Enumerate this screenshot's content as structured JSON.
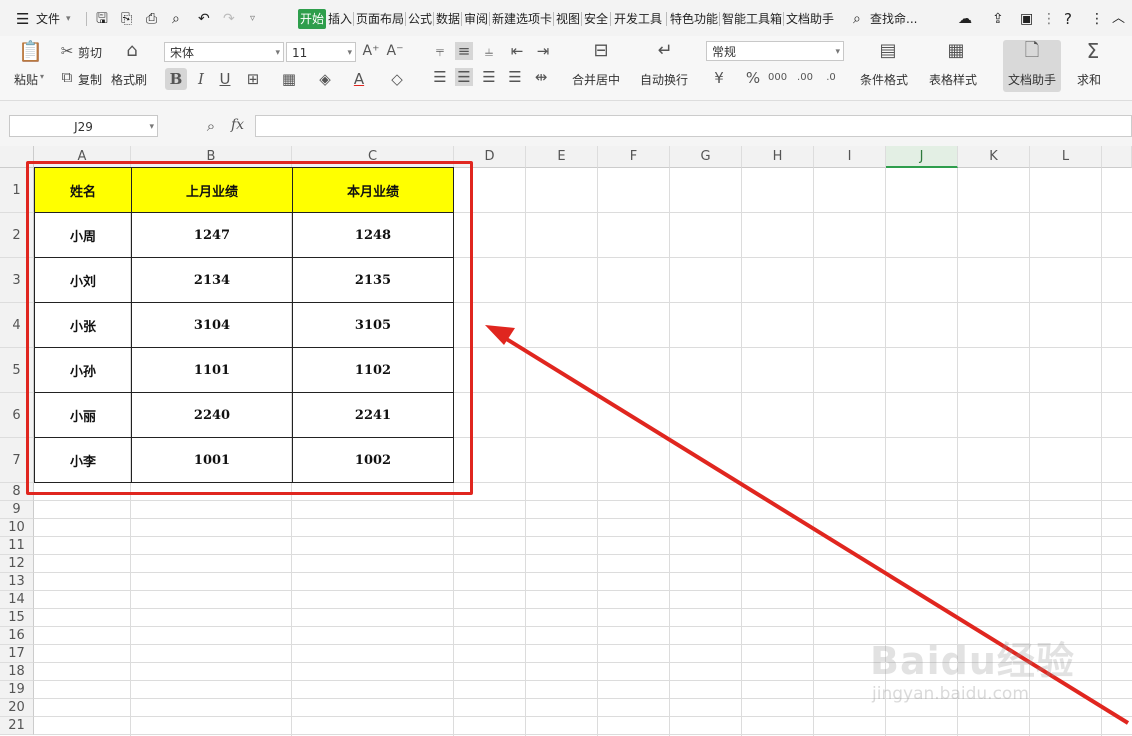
{
  "menubar": {
    "file_label": "文件",
    "tabs": [
      "开始",
      "插入",
      "页面布局",
      "公式",
      "数据",
      "审阅",
      "新建选项卡",
      "视图",
      "安全",
      "开发工具",
      "特色功能",
      "智能工具箱",
      "文档助手"
    ],
    "active_tab": "开始",
    "search_label": "查找命..."
  },
  "ribbon": {
    "paste": "粘贴",
    "cut": "剪切",
    "copy": "复制",
    "format_painter": "格式刷",
    "font_name": "宋体",
    "font_size": "11",
    "merge_center": "合并居中",
    "wrap_text": "自动换行",
    "number_format": "常规",
    "conditional_format": "条件格式",
    "table_style": "表格样式",
    "doc_assistant": "文档助手",
    "sum": "求和"
  },
  "formula_bar": {
    "cell_ref": "J29",
    "fx": "fx",
    "value": ""
  },
  "grid": {
    "columns": [
      "A",
      "B",
      "C",
      "D",
      "E",
      "F",
      "G",
      "H",
      "I",
      "J",
      "K",
      "L"
    ],
    "selected_column": "J",
    "rows": [
      "1",
      "2",
      "3",
      "4",
      "5",
      "6",
      "7",
      "8",
      "9",
      "10",
      "11",
      "12",
      "13",
      "14",
      "15",
      "16",
      "17",
      "18",
      "19",
      "20",
      "21"
    ]
  },
  "table": {
    "headers": [
      "姓名",
      "上月业绩",
      "本月业绩"
    ],
    "rows": [
      [
        "小周",
        "1247",
        "1248"
      ],
      [
        "小刘",
        "2134",
        "2135"
      ],
      [
        "小张",
        "3104",
        "3105"
      ],
      [
        "小孙",
        "1101",
        "1102"
      ],
      [
        "小丽",
        "2240",
        "2241"
      ],
      [
        "小李",
        "1001",
        "1002"
      ]
    ]
  },
  "annotation": {
    "color": "#e0261f"
  },
  "watermark": {
    "brand": "Baidu经验",
    "url": "jingyan.baidu.com"
  }
}
